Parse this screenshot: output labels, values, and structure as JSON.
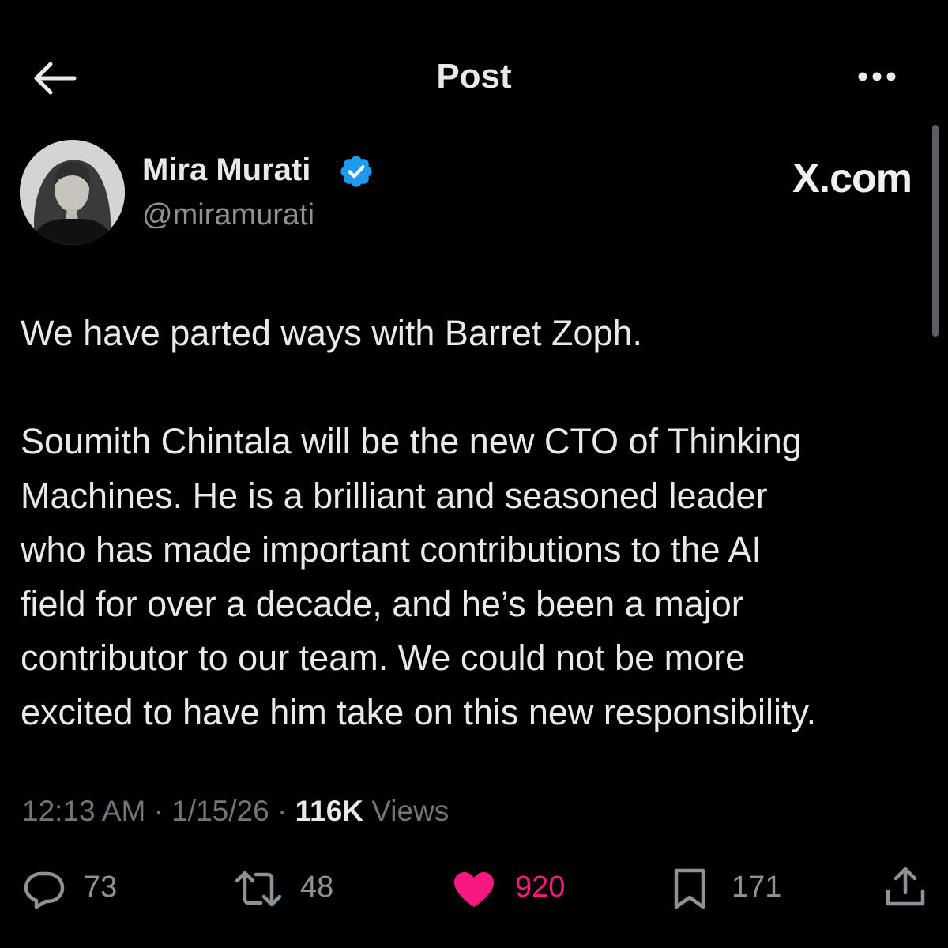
{
  "header": {
    "title": "Post"
  },
  "post": {
    "author_name": "Mira Murati",
    "author_handle": "@miramurati",
    "watermark": "X.com",
    "paragraphs": [
      [
        "We have parted ways with Barret Zoph."
      ],
      [
        "Soumith Chintala will be the new CTO of Thinking",
        "Machines. He is a brilliant and seasoned leader",
        "who has made important contributions to the AI",
        "field for over a decade, and he’s been a major",
        "contributor to our team. We could not be more",
        "excited to have him take on this new responsibility."
      ]
    ],
    "meta": {
      "time": "12:13 AM",
      "date": "1/15/26",
      "views_count": "116K",
      "views_label": "Views",
      "separator": "·"
    }
  },
  "actions": {
    "replies": "73",
    "reposts": "48",
    "likes": "920",
    "bookmarks": "171"
  },
  "icons": {
    "back": "arrow-left-icon",
    "more": "more-horizontal-icon",
    "verified": "verified-badge-icon",
    "reply": "reply-bubble-icon",
    "repost": "repost-icon",
    "like": "heart-icon",
    "bookmark": "bookmark-icon",
    "share": "share-icon"
  },
  "colors": {
    "background": "#000000",
    "text": "#e7e9ea",
    "secondary_text": "#71767b",
    "verified": "#1d9bf0",
    "like": "#f91880"
  }
}
